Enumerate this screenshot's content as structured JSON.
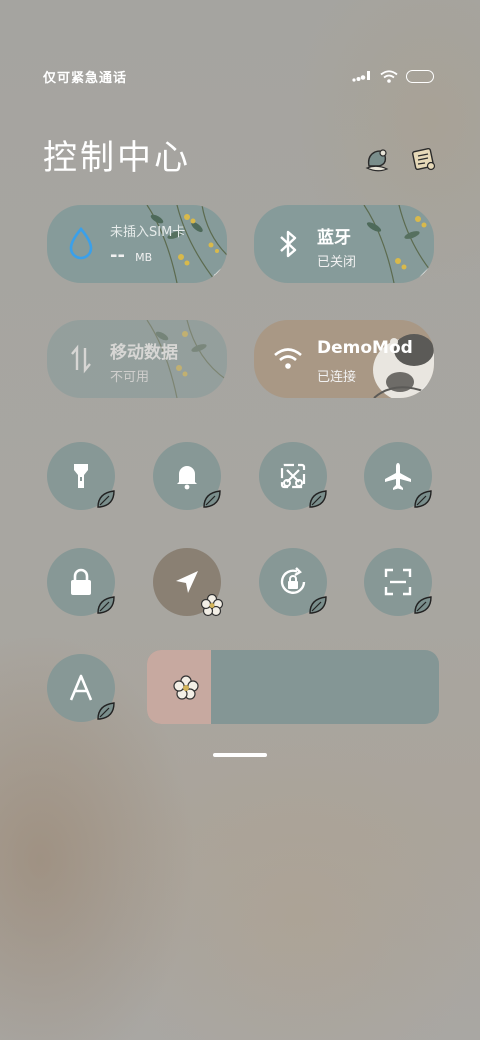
{
  "status_bar": {
    "carrier_text": "仅可紧急通话",
    "icons": [
      "signal-icon",
      "wifi-icon",
      "battery-icon"
    ]
  },
  "header": {
    "title": "控制中心",
    "icons": [
      "edit-theme-icon",
      "scroll-settings-icon"
    ]
  },
  "tiles": {
    "data_usage": {
      "title": "未插入SIM卡",
      "value": "--",
      "unit": "MB",
      "icon": "water-drop-icon"
    },
    "bluetooth": {
      "title": "蓝牙",
      "status": "已关闭",
      "icon": "bluetooth-icon"
    },
    "mobile_data": {
      "title": "移动数据",
      "status": "不可用",
      "icon": "data-transfer-icon"
    },
    "wifi": {
      "title": "DemoMod",
      "status": "已连接",
      "icon": "wifi-icon"
    }
  },
  "toggles": [
    {
      "name": "flashlight",
      "icon": "flashlight-icon",
      "active": false
    },
    {
      "name": "mute",
      "icon": "bell-icon",
      "active": false
    },
    {
      "name": "screenshot",
      "icon": "scissors-icon",
      "active": false
    },
    {
      "name": "airplane-mode",
      "icon": "airplane-icon",
      "active": false
    },
    {
      "name": "lock-screen",
      "icon": "lock-icon",
      "active": false
    },
    {
      "name": "location",
      "icon": "location-arrow-icon",
      "active": true
    },
    {
      "name": "rotation-lock",
      "icon": "rotation-lock-icon",
      "active": false
    },
    {
      "name": "scanner",
      "icon": "scan-icon",
      "active": false
    },
    {
      "name": "auto-brightness",
      "icon": "letter-a-icon",
      "active": false
    }
  ],
  "brightness": {
    "level": 0.22
  },
  "colors": {
    "tile": "#869b9a",
    "wifi_tile": "#a99885",
    "toggle": "#879896",
    "toggle_active": "#8a8073",
    "brightness_fill": "#c7a9a0",
    "brightness_track": "#849695"
  }
}
